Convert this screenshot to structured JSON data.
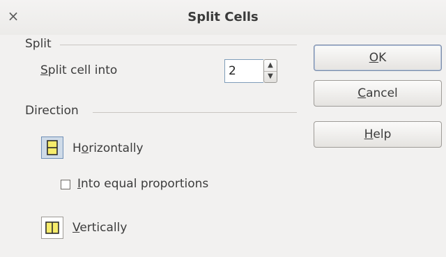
{
  "window": {
    "title": "Split Cells",
    "close_glyph": "×"
  },
  "split": {
    "section_label": "Split",
    "split_into_label": "Split cell into",
    "split_into_value": "2"
  },
  "direction": {
    "section_label": "Direction",
    "horizontal_label": "Horizontally",
    "equal_proportions_label": "Into equal proportions",
    "equal_proportions_checked": false,
    "vertical_label": "Vertically",
    "selected": "Horizontally"
  },
  "buttons": {
    "ok_label": "OK",
    "cancel_label": "Cancel",
    "help_label": "Help"
  },
  "colors": {
    "dialog_bg": "#f2f1f0",
    "icon_fill": "#f6ec6c",
    "icon_stroke": "#2b2b2b",
    "selection_bg": "#cfdbe8"
  },
  "icons": [
    "close-icon",
    "split-horizontal-icon",
    "split-vertical-icon",
    "spin-up-arrow-icon",
    "spin-down-arrow-icon"
  ]
}
